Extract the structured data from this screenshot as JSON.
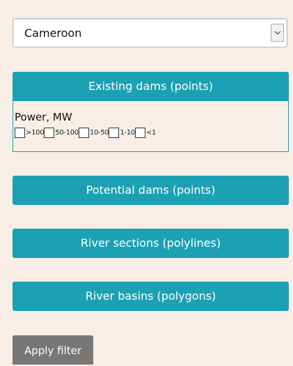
{
  "country_select": {
    "value": "Cameroon"
  },
  "layers": {
    "existing_dams": "Existing dams (points)",
    "potential_dams": "Potential dams (points)",
    "river_sections": "River sections (polylines)",
    "river_basins": "River basins (polygons)"
  },
  "existing_filter": {
    "power_label": "Power, MW",
    "options": [
      ">100",
      "50-100",
      "10-50",
      "1-10",
      "<1"
    ]
  },
  "apply_button": "Apply filter",
  "colors": {
    "accent": "#1ba1b3",
    "background": "#f8eee6",
    "apply": "#777777"
  },
  "icons": {
    "dropdown": "chevron-down-icon"
  }
}
